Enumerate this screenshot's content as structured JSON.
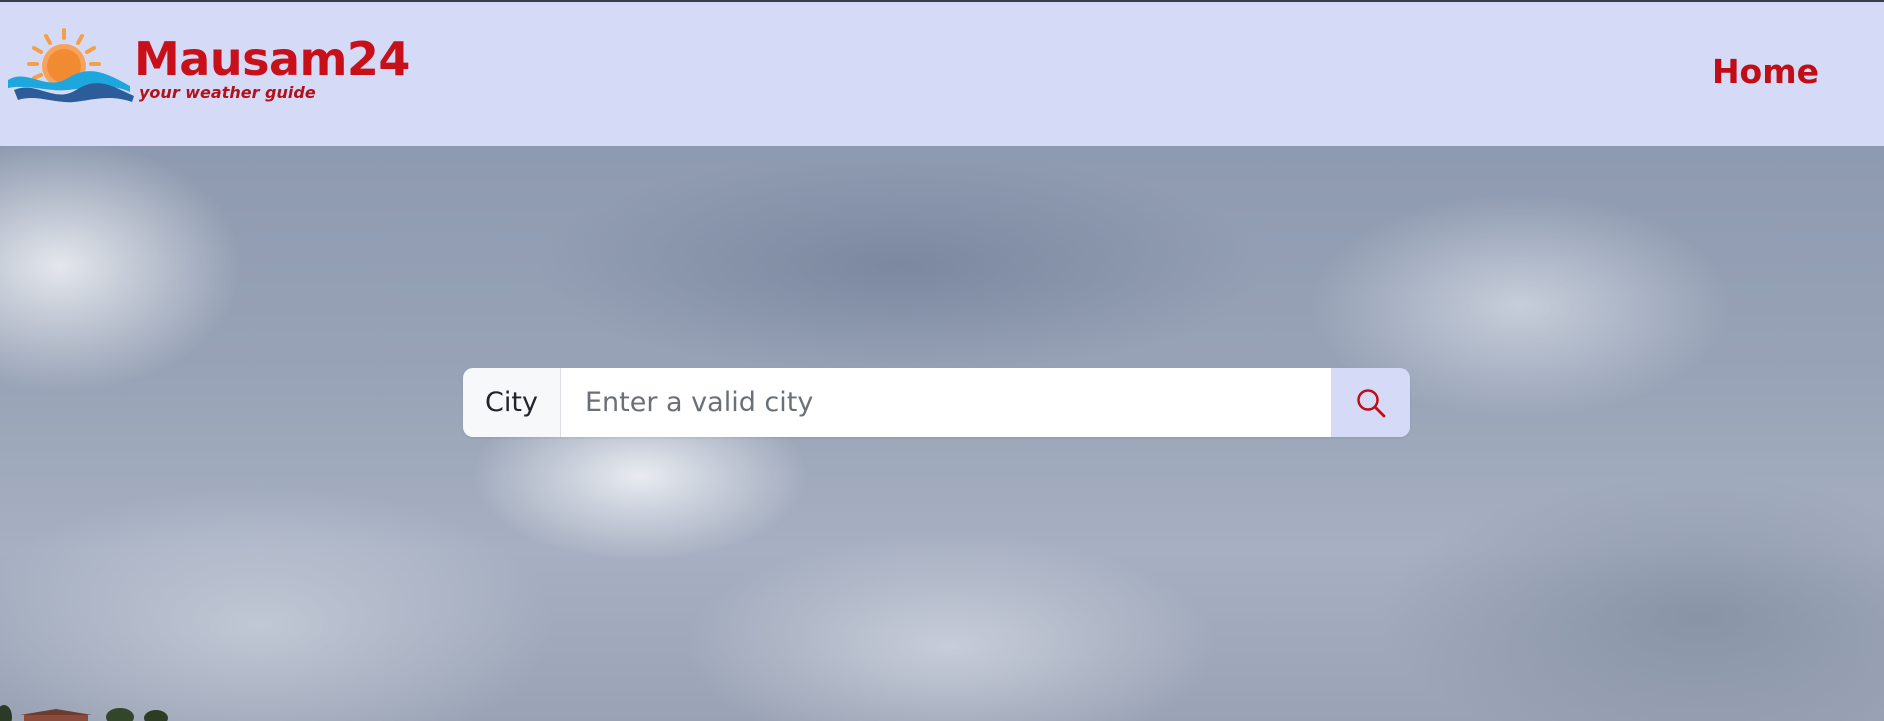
{
  "brand": {
    "name": "Mausam24",
    "tagline": "your weather guide",
    "logo_icon": "sun-over-waves-icon",
    "color": "#c8101b"
  },
  "nav": {
    "items": [
      {
        "label": "Home"
      }
    ],
    "background": "#d5dbf6"
  },
  "search": {
    "label": "City",
    "placeholder": "Enter a valid city",
    "value": "",
    "button_icon": "search-icon"
  },
  "hero": {
    "background": "cloudy-sky"
  }
}
